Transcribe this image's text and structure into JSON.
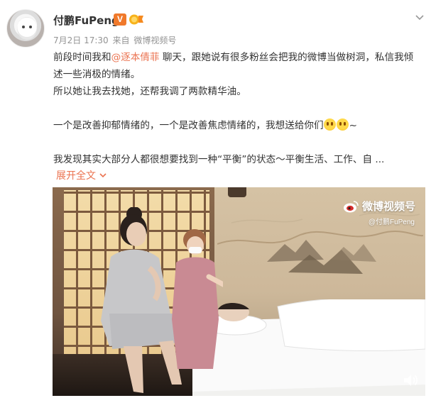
{
  "post": {
    "username": "付鹏FuPeng",
    "verified_badge": "V",
    "date": "7月2日 17:30",
    "source_prefix": "来自",
    "source": "微博视频号",
    "content": {
      "line1_before": "前段时间我和",
      "mention": "@逐本倩菲",
      "line1_after": " 聊天，跟她说有很多粉丝会把我的微博当做树洞，私信我倾述一些消极的情绪。",
      "line2": "所以她让我去找她，还帮我调了两款精华油。",
      "line3": "一个是改善抑郁情绪的，一个是改善焦虑情绪的，我想送给你们",
      "line3_tail": "~",
      "line4": "我发现其实大部分人都很想要找到一种“平衡”的状态～平衡生活、工作、自 ..."
    },
    "expand_label": "展开全文",
    "icons": [
      "avatar",
      "verified-icon",
      "medal-icon",
      "chevron-down-icon",
      "emoji-icon",
      "weibo-logo-icon",
      "mute-icon"
    ]
  },
  "video": {
    "watermark_title": "微博视频号",
    "watermark_sub": "@付鹏FuPeng"
  },
  "colors": {
    "accent": "#eb7350",
    "badge": "#f0792b",
    "meta_gray": "#939393"
  }
}
